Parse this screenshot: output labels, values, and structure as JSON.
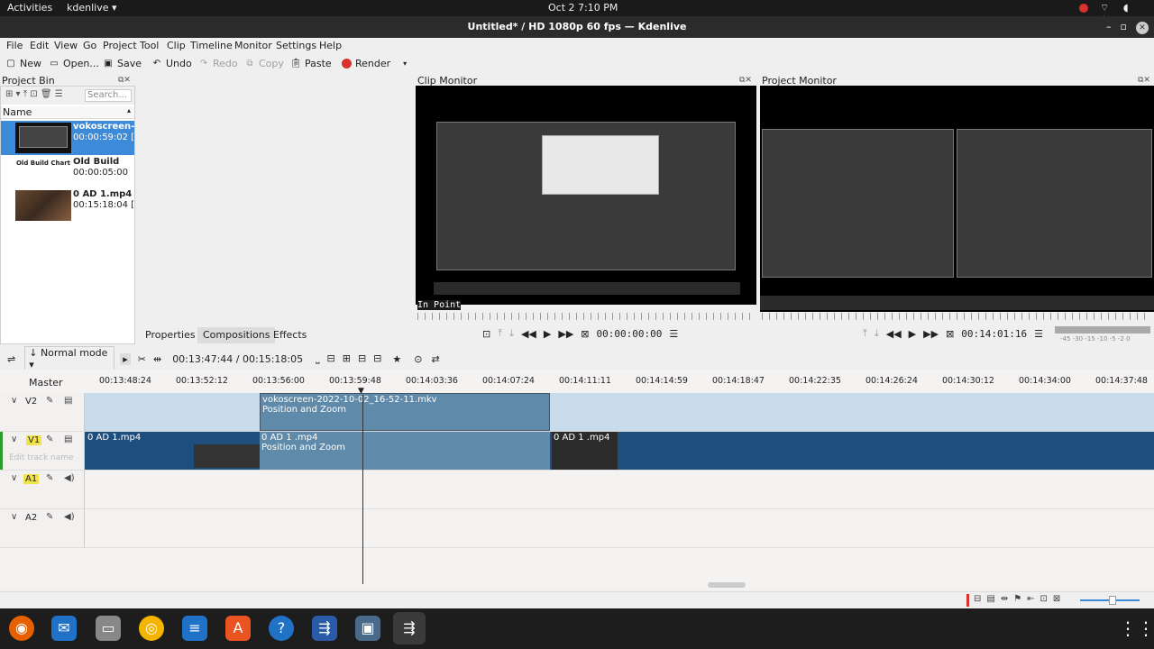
{
  "gnome": {
    "activities": "Activities",
    "app_menu": "kdenlive ▾",
    "clock": "Oct 2  7:10 PM",
    "tray": "⌔ ◖ ⏻ ▾"
  },
  "window": {
    "title": "Untitled* / HD 1080p 60 fps — Kdenlive"
  },
  "menu": [
    "File",
    "Edit",
    "View",
    "Go",
    "Project",
    "Tool",
    "Clip",
    "Timeline",
    "Monitor",
    "Settings",
    "Help"
  ],
  "toolbar": {
    "new": "New",
    "open": "Open...",
    "save": "Save",
    "undo": "Undo",
    "redo": "Redo",
    "copy": "Copy",
    "paste": "Paste",
    "render": "Render"
  },
  "bin": {
    "title": "Project Bin",
    "search_placeholder": "Search...",
    "col_name": "Name",
    "items": [
      {
        "name": "vokoscreen-20",
        "duration": "00:00:59:02 [1]",
        "selected": true
      },
      {
        "name": "Old Build",
        "duration": "00:00:05:00",
        "thumb_label": "Old Build Chart"
      },
      {
        "name": "0 AD 1.mp4",
        "duration": "00:15:18:04 [3]"
      }
    ]
  },
  "props_tabs": [
    "Properties",
    "Compositions",
    "Effects"
  ],
  "clip_monitor": {
    "title": "Clip Monitor",
    "in_point": "In Point",
    "timecode": "00:00:00:00"
  },
  "project_monitor": {
    "title": "Project Monitor",
    "timecode": "00:14:01:16",
    "levels": "-45 -30  -15  -10  -5  -2  0"
  },
  "timeline_bar": {
    "mode": "Normal mode",
    "position": "00:13:47:44 / 00:15:18:05"
  },
  "ruler": [
    "00:13:48:24",
    "00:13:52:12",
    "00:13:56:00",
    "00:13:59:48",
    "00:14:03:36",
    "00:14:07:24",
    "00:14:11:11",
    "00:14:14:59",
    "00:14:18:47",
    "00:14:22:35",
    "00:14:26:24",
    "00:14:30:12",
    "00:14:34:00",
    "00:14:37:48"
  ],
  "tracks": {
    "master": "Master",
    "v2": {
      "name": "V2",
      "clip_title": "vokoscreen-2022-10-02_16-52-11.mkv",
      "clip_effect": "Position and Zoom"
    },
    "v1": {
      "name": "V1",
      "clip_a": "0 AD 1.mp4",
      "clip_b": "0 AD 1 .mp4",
      "clip_b_effect": "Position and Zoom",
      "clip_c": "0 AD 1 .mp4",
      "edit_placeholder": "Edit track name"
    },
    "a1": {
      "name": "A1"
    },
    "a2": {
      "name": "A2"
    }
  },
  "colors": {
    "selection": "#3d8ad8",
    "v1_track": "#1d4e7e",
    "v2_track": "#c8dbea",
    "clip": "#5f8aa9",
    "record": "#d9312b"
  }
}
